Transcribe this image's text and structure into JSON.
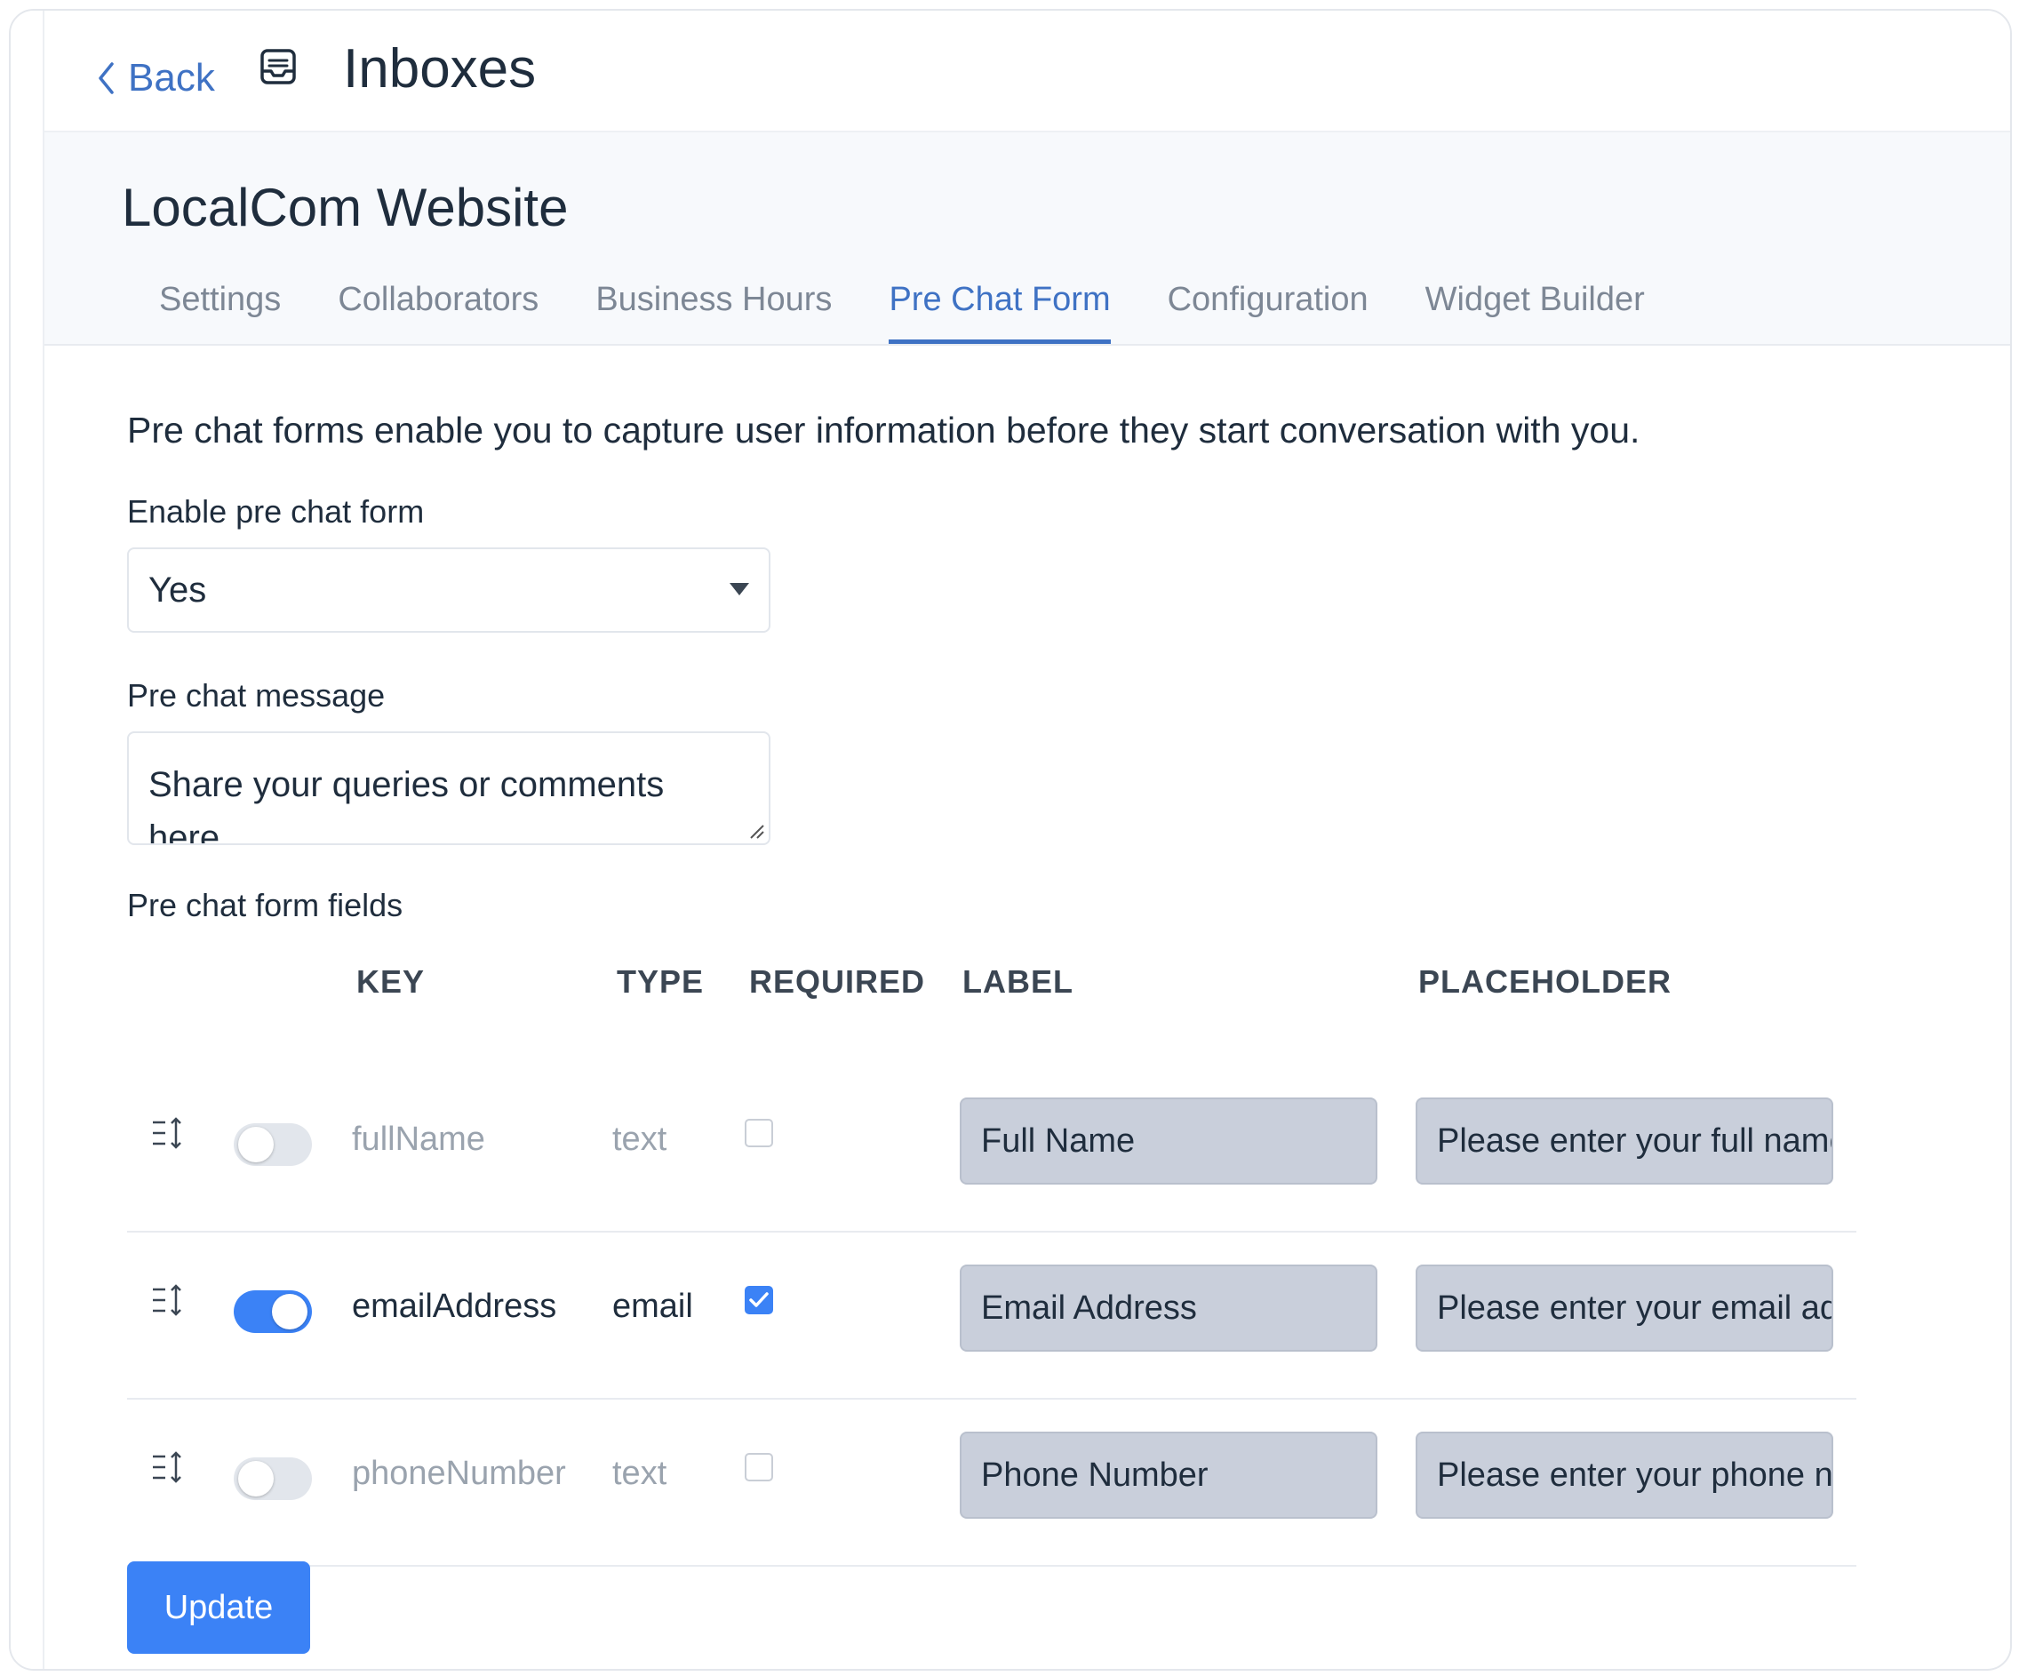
{
  "header": {
    "back_label": "Back",
    "title": "Inboxes"
  },
  "inbox": {
    "name": "LocalCom Website"
  },
  "tabs": [
    {
      "label": "Settings"
    },
    {
      "label": "Collaborators"
    },
    {
      "label": "Business Hours"
    },
    {
      "label": "Pre Chat Form",
      "active": true
    },
    {
      "label": "Configuration"
    },
    {
      "label": "Widget Builder"
    }
  ],
  "form": {
    "description": "Pre chat forms enable you to capture user information before they start conversation with you.",
    "enable_label": "Enable pre chat form",
    "enable_value": "Yes",
    "message_label": "Pre chat message",
    "message_value": "Share your queries or comments here.",
    "fields_label": "Pre chat form fields",
    "columns": {
      "key": "KEY",
      "type": "TYPE",
      "required": "REQUIRED",
      "label": "LABEL",
      "placeholder": "PLACEHOLDER"
    },
    "rows": [
      {
        "enabled": false,
        "key": "fullName",
        "type": "text",
        "required": false,
        "label": "Full Name",
        "placeholder": "Please enter your full name"
      },
      {
        "enabled": true,
        "key": "emailAddress",
        "type": "email",
        "required": true,
        "label": "Email Address",
        "placeholder": "Please enter your email address"
      },
      {
        "enabled": false,
        "key": "phoneNumber",
        "type": "text",
        "required": false,
        "label": "Phone Number",
        "placeholder": "Please enter your phone number"
      }
    ],
    "update_label": "Update"
  },
  "colors": {
    "accent": "#3f72c4",
    "button": "#3b82f6",
    "field_bg": "#c9cfdb"
  }
}
